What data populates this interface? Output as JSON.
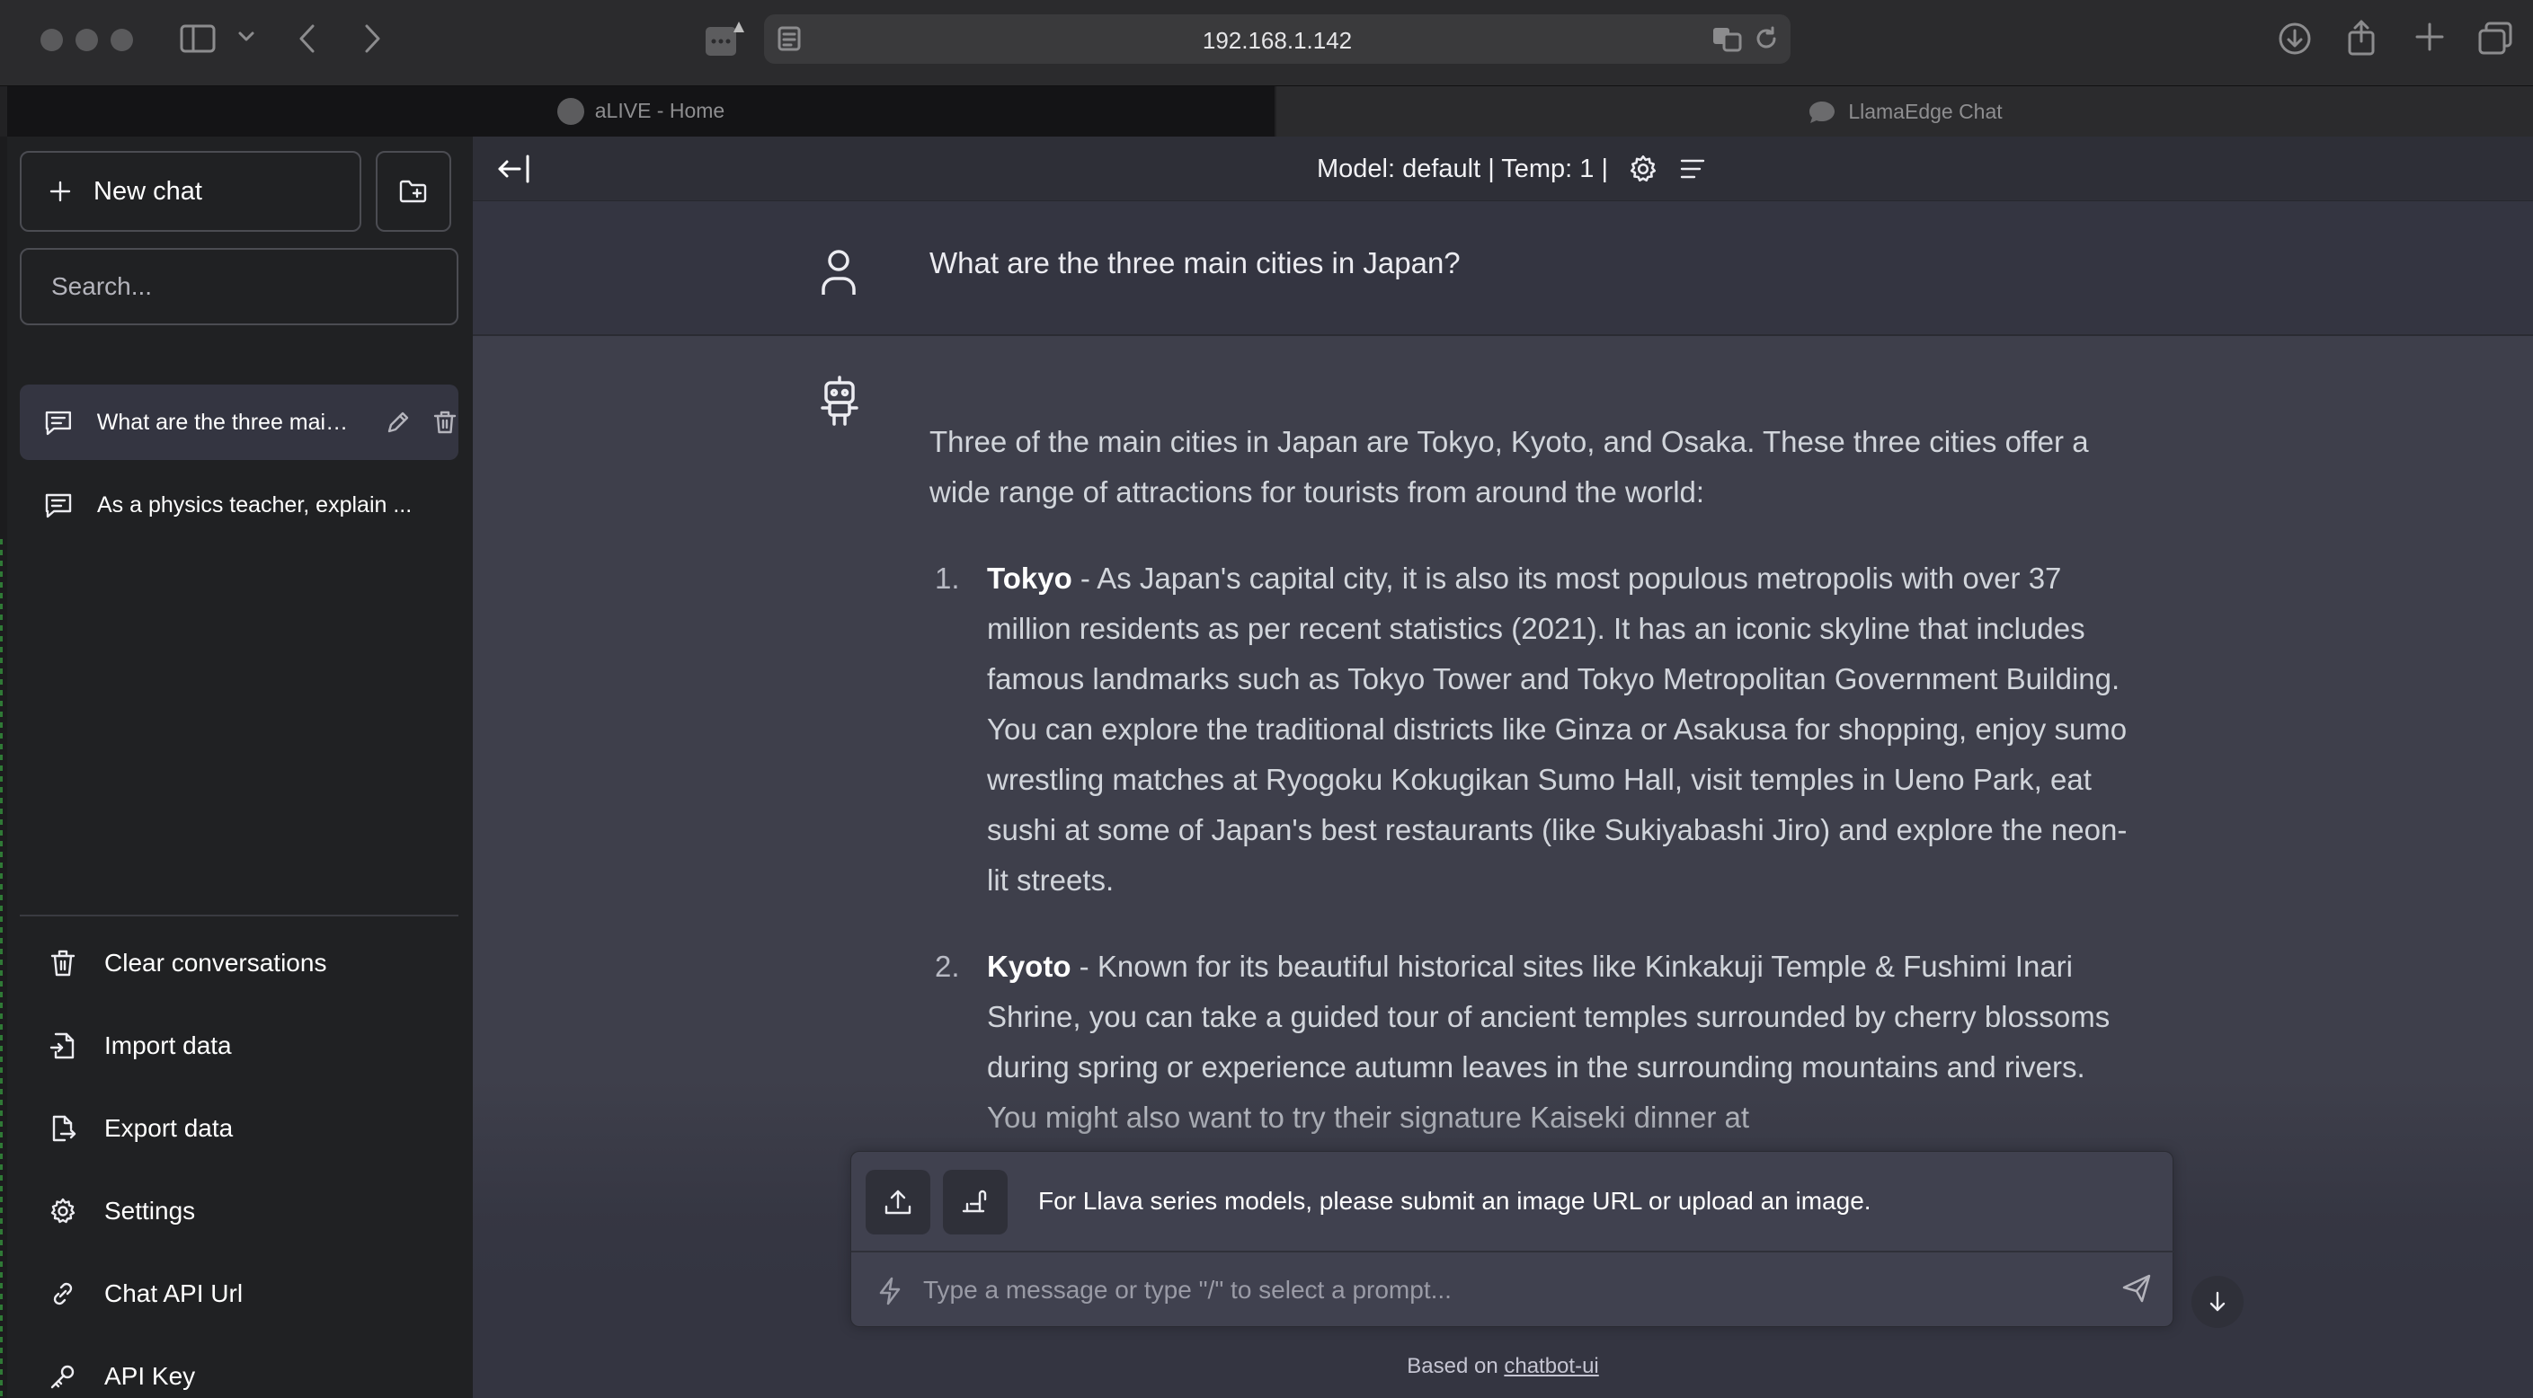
{
  "browser": {
    "address": "192.168.1.142",
    "tabs": [
      {
        "label": "aLIVE - Home",
        "active": true
      },
      {
        "label": "LlamaEdge Chat",
        "active": false
      }
    ]
  },
  "sidebar": {
    "new_chat_label": "New chat",
    "search_placeholder": "Search...",
    "conversations": [
      {
        "title": "What are the three main cities in Japan?",
        "active": true
      },
      {
        "title": "As a physics teacher, explain ...",
        "active": false
      }
    ],
    "menu": [
      {
        "label": "Clear conversations",
        "icon": "trash-icon"
      },
      {
        "label": "Import data",
        "icon": "file-import-icon"
      },
      {
        "label": "Export data",
        "icon": "file-export-icon"
      },
      {
        "label": "Settings",
        "icon": "settings-icon"
      },
      {
        "label": "Chat API Url",
        "icon": "link-icon"
      },
      {
        "label": "API Key",
        "icon": "key-icon"
      }
    ]
  },
  "header": {
    "model_info": "Model: default | Temp: 1 |"
  },
  "chat": {
    "user_message": "What are the three main cities in Japan?",
    "assistant": {
      "intro": "Three of the main cities in Japan are Tokyo, Kyoto, and Osaka. These three cities offer a wide range of attractions for tourists from around the world:",
      "items": [
        {
          "num": "1.",
          "title": "Tokyo",
          "text": " - As Japan's capital city, it is also its most populous metropolis with over 37 million residents as per recent statistics (2021). It has an iconic skyline that includes famous landmarks such as Tokyo Tower and Tokyo Metropolitan Government Building. You can explore the traditional districts like Ginza or Asakusa for shopping, enjoy sumo wrestling matches at Ryogoku Kokugikan Sumo Hall, visit temples in Ueno Park, eat sushi at some of Japan's best restaurants (like Sukiyabashi Jiro) and explore the neon-lit streets."
        },
        {
          "num": "2.",
          "title": "Kyoto",
          "text": " - Known for its beautiful historical sites like Kinkakuji Temple & Fushimi Inari Shrine, you can take a guided tour of ancient temples surrounded by cherry blossoms during spring or experience autumn leaves in the surrounding mountains and rivers. You might also want to try their signature Kaiseki dinner at"
        }
      ]
    }
  },
  "input": {
    "llava_note": "For Llava series models, please submit an image URL or upload an image.",
    "placeholder": "Type a message or type \"/\" to select a prompt..."
  },
  "footer": {
    "prefix": "Based on",
    "link": "chatbot-ui"
  }
}
